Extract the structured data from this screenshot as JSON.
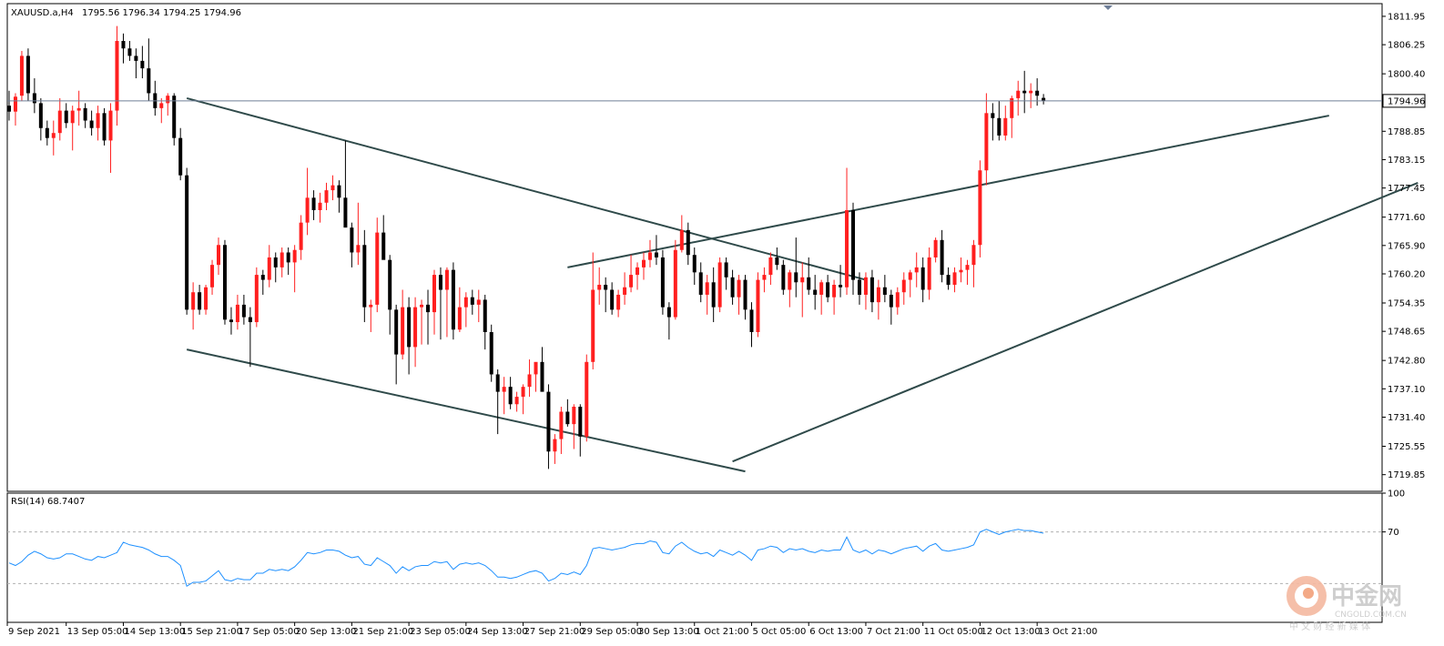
{
  "header": {
    "symbol": "XAUUSD.a,H4",
    "ohlc": "1795.56 1796.34 1794.25 1794.96"
  },
  "current_price_label": "1794.96",
  "rsi_header": "RSI(14) 68.7407",
  "watermark": {
    "name": "中金网",
    "url": "CNGOLD.COM.CN",
    "tagline": "中 文 财 经 新 媒 体"
  },
  "colors": {
    "up": "#ff1f1f",
    "down": "#000000",
    "neutral": "#2bbf3a",
    "trendline": "#2f4a4a",
    "price_line": "#6f7f98",
    "rsi_line": "#1e90ff",
    "grid_dash": "#b0b0b0"
  },
  "chart_data": [
    {
      "type": "candlestick",
      "symbol": "XAUUSD.a",
      "timeframe": "H4",
      "ylim": [
        1716.5,
        1814.5
      ],
      "y_ticks": [
        "1811.95",
        "1806.25",
        "1800.40",
        "1794.96",
        "1788.85",
        "1783.15",
        "1777.45",
        "1771.60",
        "1765.90",
        "1760.20",
        "1754.35",
        "1748.65",
        "1742.80",
        "1737.10",
        "1731.40",
        "1725.55",
        "1719.85"
      ],
      "x_tick_labels": [
        "9 Sep 2021",
        "13 Sep 05:00",
        "14 Sep 13:00",
        "15 Sep 21:00",
        "17 Sep 05:00",
        "20 Sep 13:00",
        "21 Sep 21:00",
        "23 Sep 05:00",
        "24 Sep 13:00",
        "27 Sep 21:00",
        "29 Sep 05:00",
        "30 Sep 13:00",
        "1 Oct 21:00",
        "5 Oct 05:00",
        "6 Oct 13:00",
        "7 Oct 21:00",
        "11 Oct 05:00",
        "12 Oct 13:00",
        "13 Oct 21:00"
      ],
      "last_price": 1794.96,
      "candles": [
        [
          1794.0,
          1797.0,
          1791.0,
          1792.8
        ],
        [
          1792.8,
          1796.5,
          1790.0,
          1795.8
        ],
        [
          1796.0,
          1805.0,
          1795.0,
          1804.0
        ],
        [
          1804.0,
          1805.5,
          1795.0,
          1796.5
        ],
        [
          1796.5,
          1799.5,
          1792.5,
          1794.5
        ],
        [
          1794.5,
          1795.5,
          1787.0,
          1789.5
        ],
        [
          1789.5,
          1791.0,
          1786.0,
          1787.5
        ],
        [
          1787.5,
          1791.0,
          1784.0,
          1788.5
        ],
        [
          1788.5,
          1795.5,
          1787.0,
          1793.0
        ],
        [
          1793.0,
          1794.5,
          1789.5,
          1790.5
        ],
        [
          1790.5,
          1794.0,
          1785.0,
          1793.0
        ],
        [
          1793.0,
          1797.0,
          1790.0,
          1793.5
        ],
        [
          1793.5,
          1794.5,
          1789.5,
          1791.0
        ],
        [
          1791.0,
          1793.0,
          1788.0,
          1789.5
        ],
        [
          1789.5,
          1794.0,
          1787.0,
          1792.5
        ],
        [
          1792.5,
          1793.5,
          1786.0,
          1787.0
        ],
        [
          1787.0,
          1794.5,
          1780.5,
          1793.0
        ],
        [
          1793.0,
          1810.0,
          1790.0,
          1807.0
        ],
        [
          1807.0,
          1808.5,
          1802.5,
          1805.5
        ],
        [
          1805.5,
          1807.0,
          1803.0,
          1804.0
        ],
        [
          1804.0,
          1805.5,
          1799.5,
          1803.0
        ],
        [
          1803.0,
          1806.0,
          1799.5,
          1801.5
        ],
        [
          1801.5,
          1807.5,
          1795.0,
          1796.5
        ],
        [
          1796.5,
          1799.0,
          1792.0,
          1793.5
        ],
        [
          1793.5,
          1795.5,
          1790.5,
          1794.5
        ],
        [
          1794.5,
          1796.5,
          1792.0,
          1796.0
        ],
        [
          1796.0,
          1796.5,
          1786.0,
          1787.5
        ],
        [
          1787.5,
          1789.5,
          1779.0,
          1780.0
        ],
        [
          1780.0,
          1781.5,
          1752.0,
          1753.0
        ],
        [
          1753.0,
          1758.5,
          1749.0,
          1756.5
        ],
        [
          1756.5,
          1758.0,
          1752.0,
          1753.0
        ],
        [
          1753.0,
          1758.0,
          1752.0,
          1757.5
        ],
        [
          1757.5,
          1763.0,
          1756.0,
          1762.0
        ],
        [
          1762.0,
          1767.5,
          1760.0,
          1766.0
        ],
        [
          1766.0,
          1767.0,
          1750.0,
          1751.0
        ],
        [
          1751.0,
          1753.5,
          1748.0,
          1750.5
        ],
        [
          1750.5,
          1756.0,
          1749.0,
          1754.0
        ],
        [
          1754.0,
          1756.0,
          1750.0,
          1751.5
        ],
        [
          1751.5,
          1753.5,
          1741.5,
          1750.5
        ],
        [
          1750.5,
          1761.5,
          1749.5,
          1760.0
        ],
        [
          1760.0,
          1761.0,
          1756.0,
          1759.0
        ],
        [
          1759.0,
          1766.0,
          1757.5,
          1763.5
        ],
        [
          1763.5,
          1764.5,
          1758.5,
          1761.5
        ],
        [
          1761.5,
          1765.5,
          1759.5,
          1764.5
        ],
        [
          1764.5,
          1765.5,
          1760.0,
          1762.5
        ],
        [
          1762.5,
          1766.0,
          1756.5,
          1765.0
        ],
        [
          1765.0,
          1772.0,
          1763.0,
          1770.5
        ],
        [
          1770.5,
          1781.5,
          1768.0,
          1775.5
        ],
        [
          1775.5,
          1777.0,
          1771.0,
          1773.0
        ],
        [
          1773.0,
          1776.5,
          1770.5,
          1774.5
        ],
        [
          1774.5,
          1778.5,
          1773.0,
          1777.0
        ],
        [
          1777.0,
          1780.0,
          1775.0,
          1778.0
        ],
        [
          1778.0,
          1779.0,
          1772.5,
          1775.5
        ],
        [
          1775.5,
          1787.0,
          1771.0,
          1769.5
        ],
        [
          1769.5,
          1770.5,
          1761.5,
          1764.5
        ],
        [
          1764.5,
          1774.5,
          1762.0,
          1766.0
        ],
        [
          1766.0,
          1769.0,
          1750.5,
          1753.5
        ],
        [
          1753.5,
          1755.0,
          1748.5,
          1754.0
        ],
        [
          1754.0,
          1771.5,
          1752.5,
          1768.5
        ],
        [
          1768.5,
          1772.0,
          1767.0,
          1763.0
        ],
        [
          1763.0,
          1764.0,
          1748.0,
          1753.0
        ],
        [
          1753.0,
          1754.0,
          1738.0,
          1744.0
        ],
        [
          1744.0,
          1757.0,
          1743.0,
          1753.5
        ],
        [
          1753.5,
          1755.5,
          1740.0,
          1745.5
        ],
        [
          1745.5,
          1755.5,
          1741.5,
          1753.5
        ],
        [
          1753.5,
          1755.0,
          1746.0,
          1754.0
        ],
        [
          1754.0,
          1757.0,
          1746.0,
          1752.5
        ],
        [
          1752.5,
          1761.0,
          1748.0,
          1760.0
        ],
        [
          1760.0,
          1761.5,
          1747.0,
          1757.0
        ],
        [
          1757.0,
          1761.5,
          1747.5,
          1761.0
        ],
        [
          1761.0,
          1762.5,
          1747.0,
          1749.0
        ],
        [
          1749.0,
          1757.5,
          1748.5,
          1753.5
        ],
        [
          1753.5,
          1756.5,
          1749.5,
          1755.5
        ],
        [
          1755.5,
          1757.0,
          1752.0,
          1754.0
        ],
        [
          1754.0,
          1757.0,
          1750.5,
          1755.0
        ],
        [
          1755.0,
          1756.0,
          1745.0,
          1748.5
        ],
        [
          1748.5,
          1750.0,
          1738.5,
          1740.0
        ],
        [
          1740.0,
          1741.0,
          1728.0,
          1736.5
        ],
        [
          1736.5,
          1739.5,
          1732.0,
          1737.5
        ],
        [
          1737.5,
          1739.5,
          1733.0,
          1734.0
        ],
        [
          1734.0,
          1736.5,
          1732.5,
          1735.5
        ],
        [
          1735.5,
          1738.0,
          1732.0,
          1737.5
        ],
        [
          1737.5,
          1743.0,
          1735.5,
          1740.0
        ],
        [
          1740.0,
          1742.0,
          1736.5,
          1742.5
        ],
        [
          1742.5,
          1745.5,
          1737.0,
          1736.5
        ],
        [
          1736.5,
          1738.0,
          1721.0,
          1724.5
        ],
        [
          1724.5,
          1728.0,
          1722.0,
          1727.0
        ],
        [
          1727.0,
          1733.5,
          1724.0,
          1732.5
        ],
        [
          1732.5,
          1735.0,
          1729.5,
          1730.0
        ],
        [
          1730.0,
          1734.0,
          1725.0,
          1733.5
        ],
        [
          1733.5,
          1734.0,
          1723.5,
          1727.5
        ],
        [
          1727.5,
          1744.0,
          1726.5,
          1742.5
        ],
        [
          1742.5,
          1764.5,
          1741.0,
          1757.0
        ],
        [
          1757.0,
          1761.5,
          1754.0,
          1758.0
        ],
        [
          1758.0,
          1759.5,
          1752.5,
          1757.0
        ],
        [
          1757.0,
          1758.5,
          1752.0,
          1753.0
        ],
        [
          1753.0,
          1757.0,
          1751.5,
          1756.0
        ],
        [
          1756.0,
          1760.5,
          1754.0,
          1757.5
        ],
        [
          1757.5,
          1764.0,
          1756.5,
          1760.0
        ],
        [
          1760.0,
          1762.5,
          1757.0,
          1761.5
        ],
        [
          1761.5,
          1764.5,
          1759.0,
          1763.0
        ],
        [
          1763.0,
          1767.0,
          1761.5,
          1764.5
        ],
        [
          1764.5,
          1768.0,
          1762.0,
          1763.5
        ],
        [
          1763.5,
          1765.0,
          1752.0,
          1753.5
        ],
        [
          1753.5,
          1754.5,
          1747.0,
          1751.5
        ],
        [
          1751.5,
          1767.0,
          1751.0,
          1765.0
        ],
        [
          1765.0,
          1772.0,
          1764.5,
          1769.0
        ],
        [
          1769.0,
          1770.5,
          1762.0,
          1764.0
        ],
        [
          1764.0,
          1765.5,
          1758.0,
          1760.5
        ],
        [
          1760.5,
          1762.5,
          1754.5,
          1756.0
        ],
        [
          1756.0,
          1760.0,
          1752.0,
          1758.5
        ],
        [
          1758.5,
          1761.5,
          1750.5,
          1753.5
        ],
        [
          1753.5,
          1763.5,
          1752.5,
          1762.5
        ],
        [
          1762.5,
          1763.5,
          1757.0,
          1759.5
        ],
        [
          1759.5,
          1761.0,
          1754.0,
          1755.5
        ],
        [
          1755.5,
          1760.0,
          1752.0,
          1759.0
        ],
        [
          1759.0,
          1760.0,
          1751.0,
          1753.0
        ],
        [
          1753.0,
          1754.5,
          1745.5,
          1748.5
        ],
        [
          1748.5,
          1760.5,
          1747.5,
          1759.0
        ],
        [
          1759.0,
          1761.5,
          1756.5,
          1760.0
        ],
        [
          1760.0,
          1764.5,
          1758.0,
          1763.5
        ],
        [
          1763.5,
          1765.5,
          1761.0,
          1762.0
        ],
        [
          1762.0,
          1763.0,
          1756.0,
          1757.0
        ],
        [
          1757.0,
          1761.0,
          1753.5,
          1760.5
        ],
        [
          1760.5,
          1767.5,
          1755.5,
          1758.5
        ],
        [
          1758.5,
          1762.5,
          1751.5,
          1759.5
        ],
        [
          1759.5,
          1763.5,
          1756.0,
          1757.0
        ],
        [
          1757.0,
          1760.0,
          1753.0,
          1756.0
        ],
        [
          1756.0,
          1759.0,
          1752.0,
          1758.5
        ],
        [
          1758.5,
          1760.0,
          1754.5,
          1755.5
        ],
        [
          1755.5,
          1759.0,
          1752.0,
          1758.0
        ],
        [
          1758.0,
          1762.0,
          1755.5,
          1757.5
        ],
        [
          1757.5,
          1781.5,
          1756.0,
          1773.0
        ],
        [
          1773.0,
          1774.5,
          1756.0,
          1759.0
        ],
        [
          1759.0,
          1760.5,
          1754.0,
          1756.0
        ],
        [
          1756.0,
          1760.5,
          1753.0,
          1759.5
        ],
        [
          1759.5,
          1761.0,
          1752.5,
          1754.5
        ],
        [
          1754.5,
          1759.0,
          1751.0,
          1757.5
        ],
        [
          1757.5,
          1760.0,
          1754.5,
          1756.0
        ],
        [
          1756.0,
          1757.0,
          1750.0,
          1753.5
        ],
        [
          1753.5,
          1757.5,
          1752.0,
          1756.5
        ],
        [
          1756.5,
          1760.5,
          1754.0,
          1759.0
        ],
        [
          1759.0,
          1761.0,
          1755.5,
          1760.5
        ],
        [
          1760.5,
          1764.5,
          1757.5,
          1761.5
        ],
        [
          1761.5,
          1763.5,
          1754.5,
          1757.0
        ],
        [
          1757.0,
          1765.5,
          1755.0,
          1763.5
        ],
        [
          1763.5,
          1767.5,
          1762.5,
          1767.0
        ],
        [
          1767.0,
          1769.0,
          1758.5,
          1760.0
        ],
        [
          1760.0,
          1761.5,
          1757.0,
          1758.0
        ],
        [
          1758.0,
          1761.5,
          1756.5,
          1760.5
        ],
        [
          1760.5,
          1763.5,
          1758.5,
          1761.0
        ],
        [
          1761.0,
          1763.0,
          1758.0,
          1762.0
        ],
        [
          1762.0,
          1767.0,
          1757.5,
          1766.0
        ],
        [
          1766.0,
          1783.0,
          1763.5,
          1781.0
        ],
        [
          1781.0,
          1796.5,
          1778.0,
          1792.5
        ],
        [
          1792.5,
          1794.5,
          1787.0,
          1791.5
        ],
        [
          1791.5,
          1795.0,
          1787.0,
          1788.0
        ],
        [
          1788.0,
          1794.0,
          1787.0,
          1791.5
        ],
        [
          1791.5,
          1796.0,
          1787.5,
          1795.5
        ],
        [
          1795.5,
          1799.0,
          1792.0,
          1797.0
        ],
        [
          1797.0,
          1801.0,
          1792.5,
          1796.5
        ],
        [
          1796.5,
          1798.5,
          1793.5,
          1797.0
        ],
        [
          1797.0,
          1799.5,
          1794.0,
          1796.0
        ],
        [
          1795.56,
          1796.34,
          1794.25,
          1794.96
        ]
      ],
      "trendlines": [
        {
          "name": "falling-channel-upper",
          "from": [
            28,
            1795.5
          ],
          "to": [
            135,
            1759.0
          ]
        },
        {
          "name": "falling-channel-lower",
          "from": [
            28,
            1745.0
          ],
          "to": [
            116,
            1720.5
          ]
        },
        {
          "name": "rising-channel-upper",
          "from": [
            88,
            1761.5
          ],
          "to": [
            208,
            1792.0
          ]
        },
        {
          "name": "rising-channel-lower",
          "from": [
            114,
            1722.5
          ],
          "to": [
            222,
            1778.5
          ]
        }
      ]
    },
    {
      "type": "line",
      "name": "RSI(14)",
      "last_value": 68.7407,
      "ylim": [
        0,
        100
      ],
      "y_ticks": [
        "100",
        "70"
      ],
      "levels": [
        70,
        30
      ],
      "values": [
        46,
        44,
        47,
        52,
        55,
        53,
        50,
        49,
        50,
        53,
        53,
        51,
        49,
        48,
        51,
        50,
        52,
        54,
        62,
        60,
        59,
        58,
        56,
        53,
        51,
        51,
        48,
        44,
        28,
        31,
        31,
        32,
        36,
        40,
        33,
        32,
        34,
        33,
        33,
        38,
        38,
        41,
        40,
        41,
        40,
        43,
        48,
        54,
        53,
        54,
        56,
        56,
        55,
        52,
        50,
        51,
        45,
        44,
        50,
        47,
        44,
        38,
        43,
        40,
        43,
        44,
        44,
        47,
        46,
        47,
        41,
        45,
        46,
        45,
        46,
        44,
        40,
        35,
        35,
        34,
        35,
        37,
        39,
        40,
        38,
        32,
        34,
        38,
        37,
        39,
        37,
        44,
        57,
        58,
        57,
        56,
        57,
        58,
        60,
        61,
        61,
        63,
        62,
        54,
        53,
        59,
        62,
        58,
        55,
        53,
        54,
        51,
        56,
        54,
        52,
        55,
        52,
        48,
        56,
        57,
        59,
        58,
        54,
        57,
        56,
        57,
        55,
        54,
        56,
        55,
        56,
        56,
        66,
        56,
        54,
        56,
        53,
        56,
        55,
        53,
        55,
        57,
        58,
        59,
        55,
        59,
        61,
        56,
        55,
        56,
        57,
        58,
        60,
        70,
        72,
        70,
        68,
        70,
        71,
        72,
        71,
        71,
        70,
        69
      ]
    }
  ]
}
